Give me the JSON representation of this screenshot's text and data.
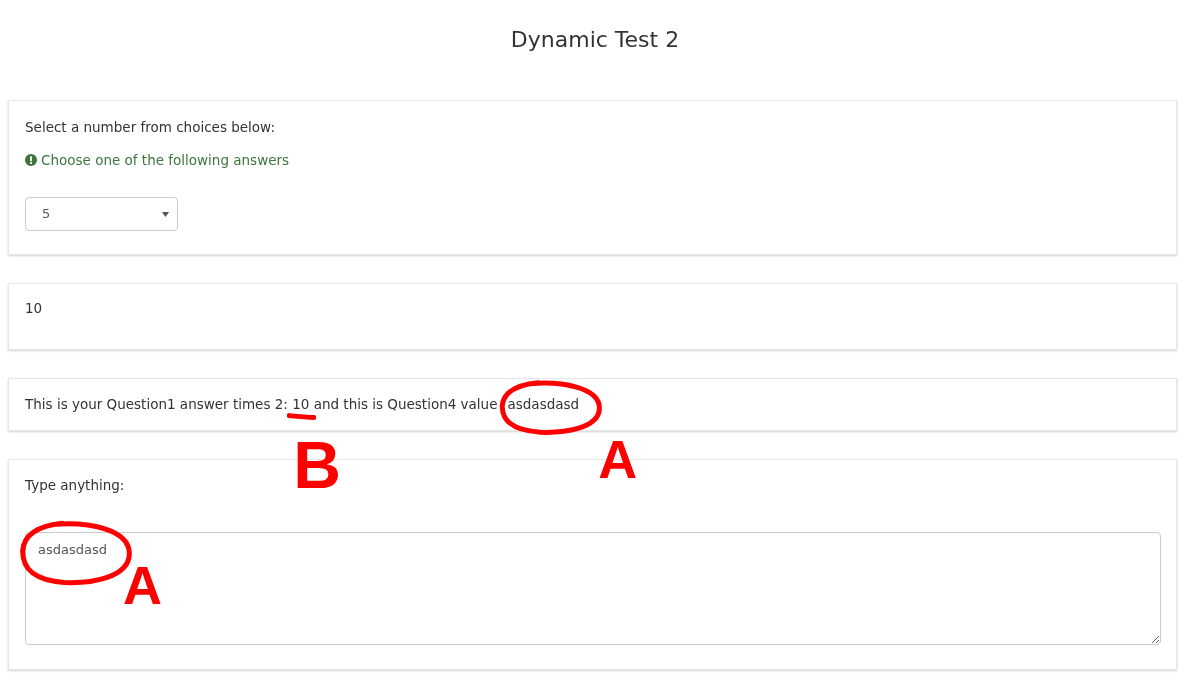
{
  "page": {
    "title": "Dynamic Test 2"
  },
  "panels": [
    {
      "kind": "select",
      "label": "Select a number from choices below:",
      "hint": "Choose one of the following answers",
      "select": {
        "value": "5"
      }
    },
    {
      "kind": "output",
      "value": "10"
    },
    {
      "kind": "sentence",
      "parts": [
        {
          "text": "This is your Question1 answer times 2: "
        },
        {
          "text": "10",
          "annotation": {
            "kind": "underline",
            "note": "B"
          }
        },
        {
          "text": " and this is Question4 value"
        },
        {
          "text": "asdasdasd",
          "annotation": {
            "kind": "circle",
            "note": "A"
          }
        }
      ]
    },
    {
      "kind": "textarea",
      "label": "Type anything:",
      "textarea": {
        "value": "asdasdasd",
        "annotation": {
          "kind": "circle",
          "note": "A"
        }
      }
    }
  ]
}
